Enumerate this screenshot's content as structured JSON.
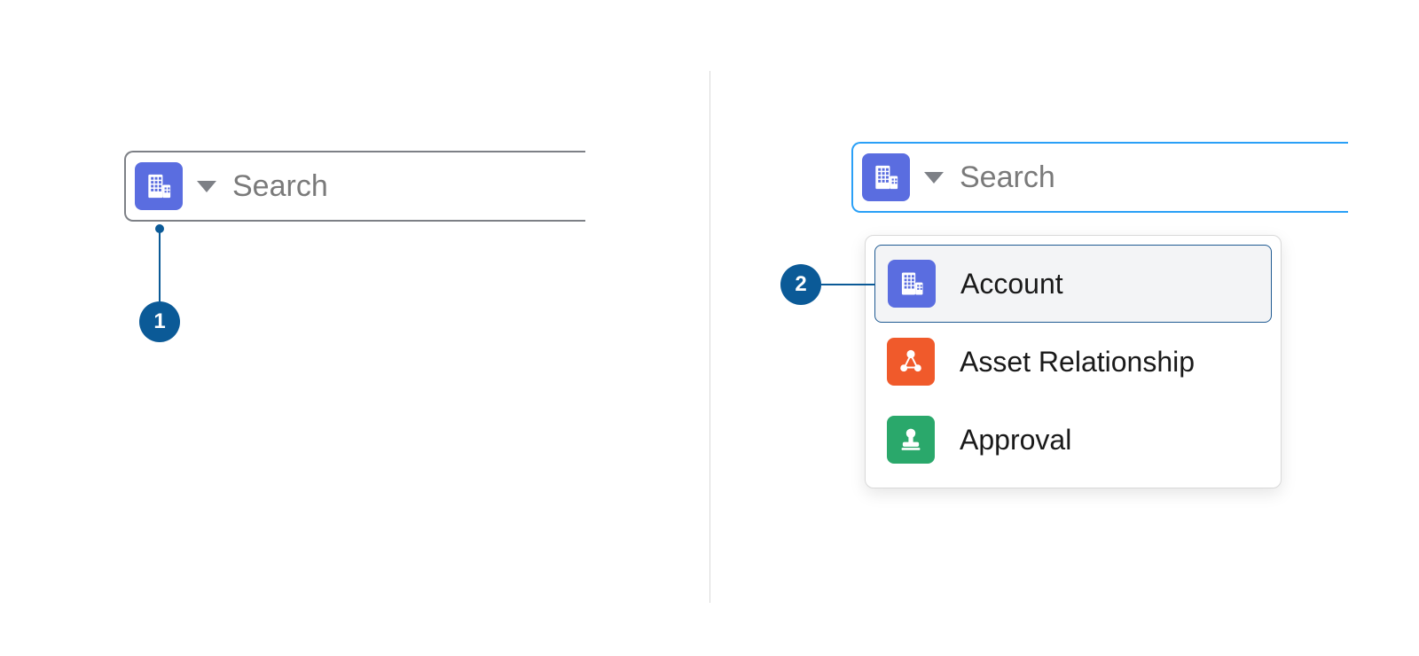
{
  "search": {
    "placeholder": "Search"
  },
  "dropdown": {
    "options": [
      {
        "label": "Account"
      },
      {
        "label": "Asset Relationship"
      },
      {
        "label": "Approval"
      }
    ]
  },
  "callouts": {
    "first": "1",
    "second": "2"
  }
}
